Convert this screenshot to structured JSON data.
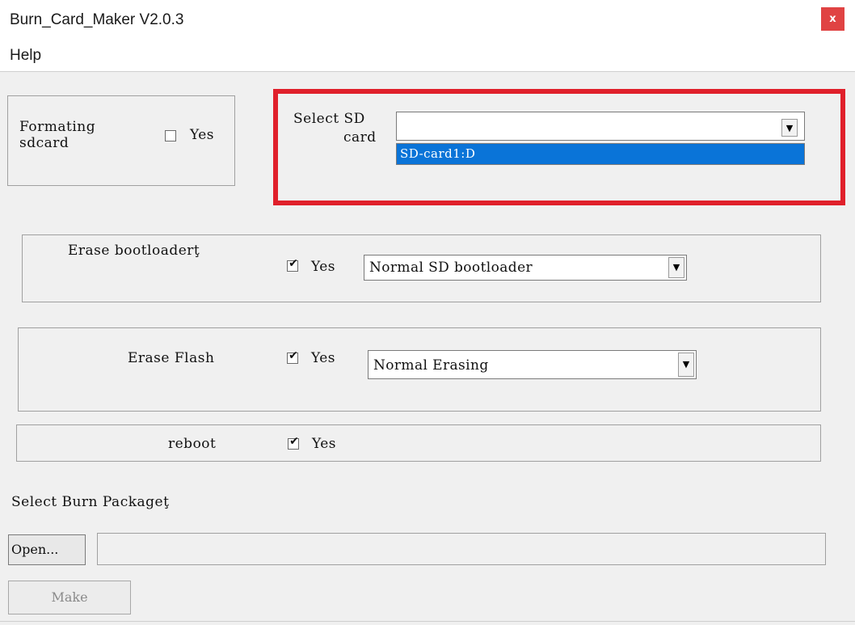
{
  "window": {
    "title": "Burn_Card_Maker V2.0.3",
    "close_label": "x"
  },
  "menu": {
    "help": "Help"
  },
  "format": {
    "label_line1": "Formating",
    "label_line2": "sdcard",
    "checkbox_label": "Yes",
    "checked": false
  },
  "sd_card": {
    "label_line1": "Select SD",
    "label_line2": "card",
    "value": "",
    "options": [
      "SD-card1:D"
    ]
  },
  "erase_bootloader": {
    "label": "Erase bootloaderţ",
    "checkbox_label": "Yes",
    "checked": true,
    "select_value": "Normal SD bootloader"
  },
  "erase_flash": {
    "label": "Erase Flash",
    "checkbox_label": "Yes",
    "checked": true,
    "select_value": "Normal Erasing"
  },
  "reboot": {
    "label": "reboot",
    "checkbox_label": "Yes",
    "checked": true
  },
  "burn_package": {
    "label": "Select Burn Packageţ",
    "open_button": "Open...",
    "path": ""
  },
  "make_button": "Make",
  "icons": {
    "check": "check-icon",
    "dropdown": "chevron-down-icon",
    "close": "close-icon"
  },
  "colors": {
    "highlight": "#e0202b",
    "selection": "#0a74d8",
    "close": "#e04343"
  }
}
